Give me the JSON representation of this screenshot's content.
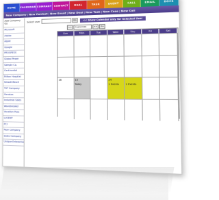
{
  "tabs": [
    "HOME",
    "CALENDAR",
    "COMPANY",
    "CONTACT",
    "DEAL",
    "TASK",
    "EVENT",
    "CALL",
    "EMAIL",
    "DOCS"
  ],
  "tab_colors": [
    "#2a4fd0",
    "#8a2bd6",
    "#9a1fd0",
    "#c0179a",
    "#d2262f",
    "#e0661a",
    "#d9a11a",
    "#6fae1a",
    "#1a9a5e",
    "#1d8fb0"
  ],
  "actions": [
    "New Company",
    "New Contact",
    "New Event",
    "New Deal",
    "New Task",
    "New Case",
    "New Call"
  ],
  "sidebar": {
    "heading": "Add Company",
    "heading2": "Go",
    "items": [
      "Microsoft",
      "Adobe",
      "Apple",
      "Google",
      "PROGRESS",
      "Global Power",
      "Sample Co.",
      "Continental",
      "Milton Hospital",
      "SmoothTouch",
      "TST Company",
      "Genstax",
      "Industrial Sales",
      "Wavebreaker",
      "Vacation Pass",
      "LUCENT",
      "PCI",
      "New Company",
      "Sales Company",
      "Unique Enterprise"
    ]
  },
  "select_label": "Select user",
  "go_label": "Go",
  "banner": "<< Show Calendar only for Selected User",
  "nav": {
    "prev": "<<",
    "view": "Customize",
    "next": ">>",
    "go": "Go"
  },
  "calendar": {
    "days": [
      "Sun",
      "Mon",
      "Tue",
      "Wed",
      "Thu",
      "Fri",
      "Sat"
    ],
    "weeks": [
      [
        {
          "n": "",
          "ev": ""
        },
        {
          "n": "",
          "ev": ""
        },
        {
          "n": "",
          "ev": ""
        },
        {
          "n": "",
          "ev": ""
        },
        {
          "n": "",
          "ev": ""
        },
        {
          "n": "",
          "ev": ""
        },
        {
          "n": "",
          "ev": ""
        }
      ],
      [
        {
          "n": "",
          "ev": ""
        },
        {
          "n": "",
          "ev": ""
        },
        {
          "n": "",
          "ev": ""
        },
        {
          "n": "",
          "ev": ""
        },
        {
          "n": "",
          "ev": ""
        },
        {
          "n": "",
          "ev": ""
        },
        {
          "n": "",
          "ev": ""
        }
      ],
      [
        {
          "n": "16",
          "ev": ""
        },
        {
          "n": "15",
          "ev": "Today",
          "hl": "grey"
        },
        {
          "n": "",
          "ev": ""
        },
        {
          "n": "24",
          "ev": "1 Events",
          "hl": "yellow"
        },
        {
          "n": "",
          "ev": "1 Events",
          "hl": "yellow"
        },
        {
          "n": "",
          "ev": ""
        },
        {
          "n": "",
          "ev": ""
        }
      ],
      [
        {
          "n": "",
          "ev": ""
        },
        {
          "n": "",
          "ev": ""
        },
        {
          "n": "",
          "ev": ""
        },
        {
          "n": "",
          "ev": ""
        },
        {
          "n": "",
          "ev": ""
        },
        {
          "n": "",
          "ev": ""
        },
        {
          "n": "",
          "ev": ""
        }
      ]
    ]
  }
}
